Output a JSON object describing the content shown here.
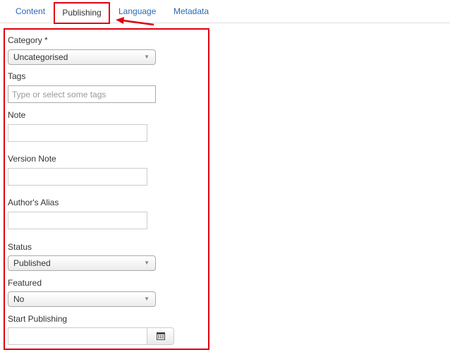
{
  "tabs": {
    "content": "Content",
    "publishing": "Publishing",
    "language": "Language",
    "metadata": "Metadata"
  },
  "form": {
    "category": {
      "label": "Category *",
      "value": "Uncategorised"
    },
    "tags": {
      "label": "Tags",
      "placeholder": "Type or select some tags"
    },
    "note": {
      "label": "Note",
      "value": ""
    },
    "version_note": {
      "label": "Version Note",
      "value": ""
    },
    "authors_alias": {
      "label": "Author's Alias",
      "value": ""
    },
    "status": {
      "label": "Status",
      "value": "Published"
    },
    "featured": {
      "label": "Featured",
      "value": "No"
    },
    "start_publishing": {
      "label": "Start Publishing",
      "value": ""
    }
  },
  "icons": {
    "dropdown": "caret-down-icon",
    "calendar": "calendar-icon",
    "annotation_arrow": "red-arrow-icon"
  },
  "colors": {
    "highlight": "#e3000f",
    "tab_link": "#2a69b8"
  }
}
